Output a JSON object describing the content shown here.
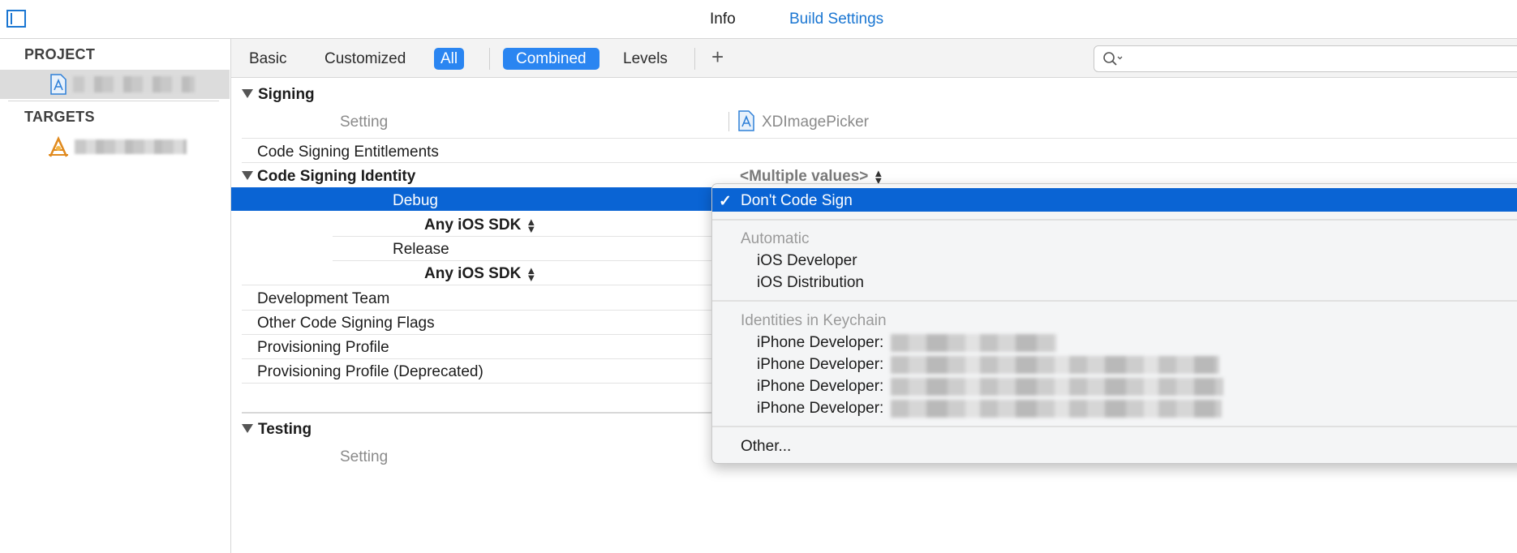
{
  "toolbar": {
    "tab_info": "Info",
    "tab_build_settings": "Build Settings"
  },
  "sidebar": {
    "project_header": "PROJECT",
    "targets_header": "TARGETS"
  },
  "filters": {
    "basic": "Basic",
    "customized": "Customized",
    "all": "All",
    "combined": "Combined",
    "levels": "Levels",
    "add": "+"
  },
  "signing": {
    "title": "Signing",
    "setting_col": "Setting",
    "target_col": "XDImagePicker",
    "entitlements": "Code Signing Entitlements",
    "identity": "Code Signing Identity",
    "identity_value": "<Multiple values>",
    "debug": "Debug",
    "any_sdk_1": "Any iOS SDK",
    "release": "Release",
    "any_sdk_2": "Any iOS SDK",
    "dev_team": "Development Team",
    "other_flags": "Other Code Signing Flags",
    "prov_profile": "Provisioning Profile",
    "prov_profile_dep": "Provisioning Profile (Deprecated)"
  },
  "testing": {
    "title": "Testing",
    "setting_col": "Setting"
  },
  "menu": {
    "check": "✓",
    "dont_sign": "Don't Code Sign",
    "automatic_header": "Automatic",
    "ios_developer": "iOS Developer",
    "ios_distribution": "iOS Distribution",
    "keychain_header": "Identities in Keychain",
    "identities": [
      "iPhone Developer:",
      "iPhone Developer:",
      "iPhone Developer:",
      "iPhone Developer:"
    ],
    "other": "Other..."
  },
  "colors": {
    "accent": "#0a64d4",
    "selected_button": "#2a85f1",
    "link_blue": "#1a76d2"
  }
}
